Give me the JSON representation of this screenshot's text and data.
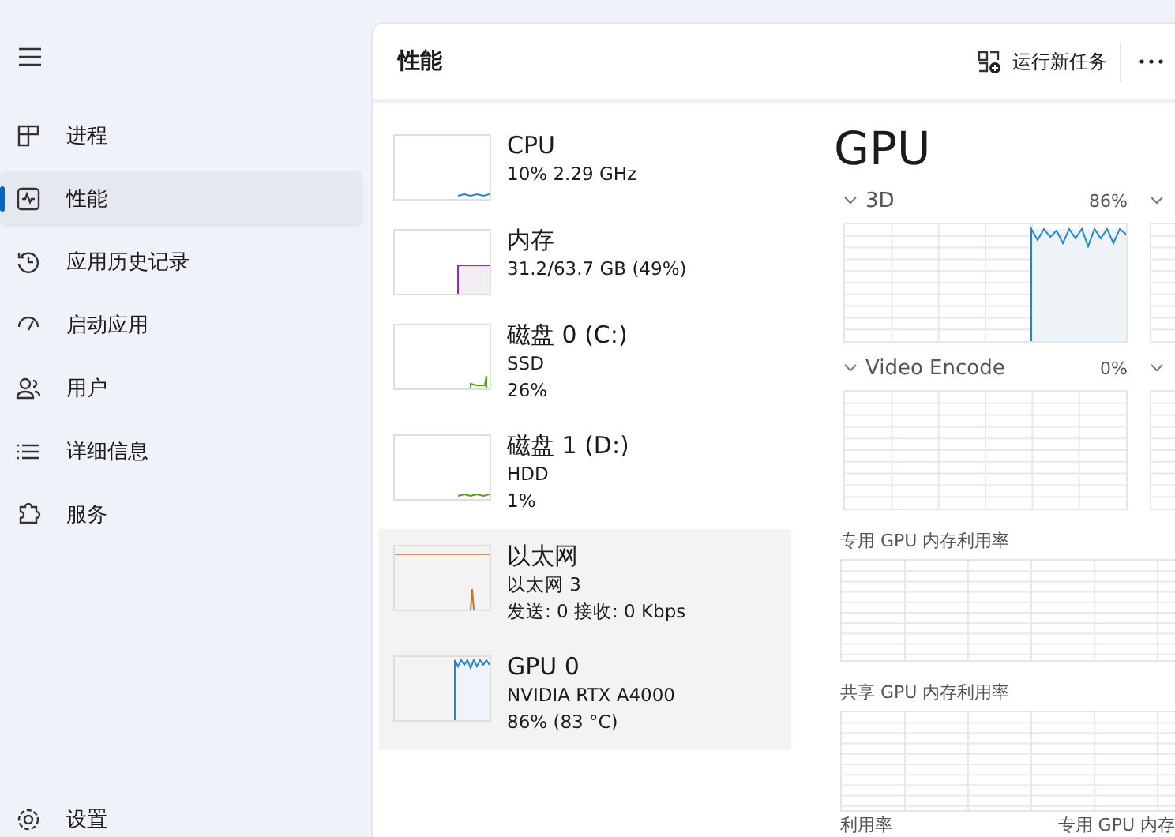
{
  "sidebar": {
    "items": [
      {
        "label": "进程",
        "selected": false
      },
      {
        "label": "性能",
        "selected": true
      },
      {
        "label": "应用历史记录",
        "selected": false
      },
      {
        "label": "启动应用",
        "selected": false
      },
      {
        "label": "用户",
        "selected": false
      },
      {
        "label": "详细信息",
        "selected": false
      },
      {
        "label": "服务",
        "selected": false
      }
    ],
    "settings": "设置"
  },
  "header": {
    "title": "性能",
    "run_task": "运行新任务"
  },
  "devices": [
    {
      "name": "CPU",
      "details": [
        "10% 2.29 GHz"
      ],
      "color": "#1f86cf",
      "kind": "flat",
      "selected": false
    },
    {
      "name": "内存",
      "details": [
        "31.2/63.7 GB (49%)"
      ],
      "color": "#8d2eb3",
      "kind": "step",
      "selected": false
    },
    {
      "name": "磁盘 0 (C:)",
      "details": [
        "SSD",
        "26%"
      ],
      "color": "#4da417",
      "kind": "spikes",
      "selected": false
    },
    {
      "name": "磁盘 1 (D:)",
      "details": [
        "HDD",
        "1%"
      ],
      "color": "#4da417",
      "kind": "flat",
      "selected": false
    },
    {
      "name": "以太网",
      "details": [
        "以太网 3",
        "发送: 0 接收: 0 Kbps"
      ],
      "color": "#c9742e",
      "kind": "spike",
      "selected": true
    },
    {
      "name": "GPU 0",
      "details": [
        "NVIDIA RTX A4000",
        "86% (83 °C)"
      ],
      "color": "#1f86cf",
      "kind": "busy",
      "selected": true
    }
  ],
  "detail": {
    "title": "GPU",
    "engines": [
      {
        "label": "3D",
        "reading": "86%",
        "kind": "busy"
      },
      {
        "label": "Video Encode",
        "reading": "0%",
        "kind": "idle"
      }
    ],
    "memory_charts": [
      {
        "label": "专用 GPU 内存利用率"
      },
      {
        "label": "共享 GPU 内存利用率"
      }
    ],
    "footer": [
      "利用率",
      "专用 GPU 内存"
    ]
  }
}
